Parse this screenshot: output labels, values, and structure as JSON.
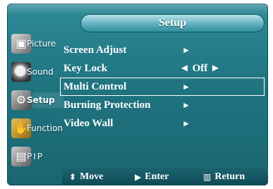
{
  "title": "Setup",
  "sidebar": {
    "items": [
      {
        "label": "Picture",
        "icon": "picture-icon"
      },
      {
        "label": "Sound",
        "icon": "sound-icon"
      },
      {
        "label": "Setup",
        "icon": "setup-icon",
        "active": true
      },
      {
        "label": "Function",
        "icon": "function-icon"
      },
      {
        "label": "PIP",
        "icon": "pip-icon"
      }
    ]
  },
  "menu": {
    "items": [
      {
        "label": "Screen Adjust",
        "arrow": "►"
      },
      {
        "label": "Key Lock",
        "value": "◄  Off  ►"
      },
      {
        "label": "Multi Control",
        "arrow": "►",
        "selected": true
      },
      {
        "label": "Burning Protection",
        "arrow": "►"
      },
      {
        "label": "Video Wall",
        "arrow": "►"
      }
    ]
  },
  "footer": {
    "move": {
      "glyph": "⬍",
      "label": "Move"
    },
    "enter": {
      "glyph": "▶",
      "label": "Enter"
    },
    "return": {
      "glyph": "▥",
      "label": "Return"
    }
  },
  "colors": {
    "panel": "#1f7480",
    "title_bar": "#67b4c2",
    "text": "#ffffff"
  }
}
